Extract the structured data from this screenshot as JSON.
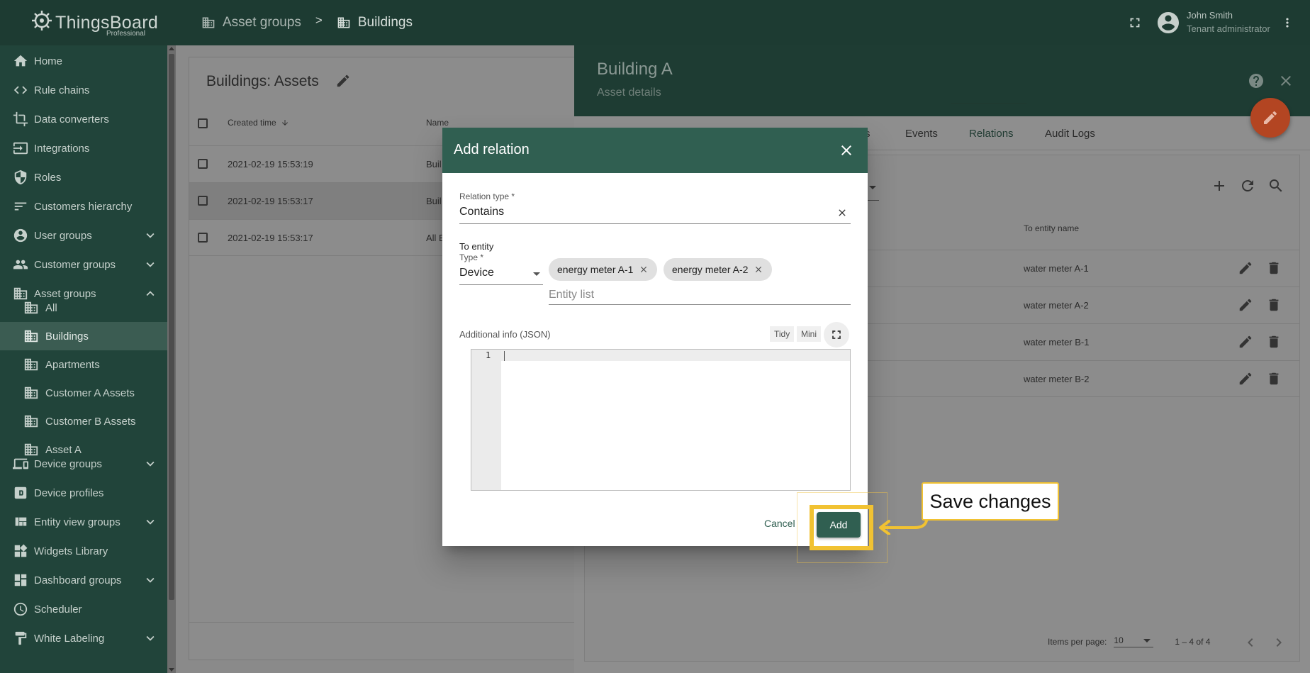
{
  "app": {
    "name": "ThingsBoard",
    "edition": "Professional"
  },
  "breadcrumb": [
    {
      "label": "Asset groups"
    },
    {
      "label": "Buildings"
    }
  ],
  "breadcrumb_separator": ">",
  "user": {
    "name": "John Smith",
    "role": "Tenant administrator"
  },
  "sidebar": {
    "items": [
      {
        "label": "Home",
        "icon": "home-icon"
      },
      {
        "label": "Rule chains",
        "icon": "code-arrows-icon"
      },
      {
        "label": "Data converters",
        "icon": "crop-icon"
      },
      {
        "label": "Integrations",
        "icon": "input-icon"
      },
      {
        "label": "Roles",
        "icon": "shield-icon"
      },
      {
        "label": "Customers hierarchy",
        "icon": "sort-lines-icon"
      },
      {
        "label": "User groups",
        "icon": "account-circle-icon",
        "expandable": true
      },
      {
        "label": "Customer groups",
        "icon": "people-icon",
        "expandable": true
      },
      {
        "label": "Asset groups",
        "icon": "building-icon",
        "expanded": true
      },
      {
        "label": "All",
        "icon": "building-icon",
        "sub": true
      },
      {
        "label": "Buildings",
        "icon": "building-icon",
        "sub": true,
        "active": true
      },
      {
        "label": "Apartments",
        "icon": "building-icon",
        "sub": true
      },
      {
        "label": "Customer A Assets",
        "icon": "building-icon",
        "sub": true
      },
      {
        "label": "Customer B Assets",
        "icon": "building-icon",
        "sub": true
      },
      {
        "label": "Asset A",
        "icon": "building-icon",
        "sub": true
      },
      {
        "label": "Device groups",
        "icon": "devices-icon",
        "expandable": true
      },
      {
        "label": "Device profiles",
        "icon": "profile-icon"
      },
      {
        "label": "Entity view groups",
        "icon": "view-quilt-icon",
        "expandable": true
      },
      {
        "label": "Widgets Library",
        "icon": "widgets-icon"
      },
      {
        "label": "Dashboard groups",
        "icon": "dashboard-icon",
        "expandable": true
      },
      {
        "label": "Scheduler",
        "icon": "clock-icon"
      },
      {
        "label": "White Labeling",
        "icon": "format-paint-icon",
        "expandable": true
      }
    ]
  },
  "asset_list": {
    "title": "Buildings: Assets",
    "columns": {
      "created": "Created time",
      "name": "Name"
    },
    "rows": [
      {
        "created": "2021-02-19 15:53:19",
        "name": "Buil"
      },
      {
        "created": "2021-02-19 15:53:17",
        "name": "Buil"
      },
      {
        "created": "2021-02-19 15:53:17",
        "name": "All E"
      }
    ]
  },
  "details": {
    "title": "Building A",
    "subtitle": "Asset details",
    "tabs": [
      {
        "label": "s"
      },
      {
        "label": "Events"
      },
      {
        "label": "Relations",
        "active": true
      },
      {
        "label": "Audit Logs"
      }
    ],
    "relations": {
      "column_to_entity_name": "To entity name",
      "rows": [
        {
          "to_entity_name": "water meter A-1"
        },
        {
          "to_entity_name": "water meter A-2"
        },
        {
          "to_entity_name": "water meter B-1"
        },
        {
          "to_entity_name": "water meter B-2"
        }
      ]
    },
    "pager": {
      "items_per_page_label": "Items per page:",
      "items_per_page": "10",
      "range": "1 – 4 of 4"
    }
  },
  "dialog": {
    "title": "Add relation",
    "relation_type_label": "Relation type *",
    "relation_type_value": "Contains",
    "to_entity_label": "To entity",
    "type_label": "Type *",
    "type_value": "Device",
    "chips": [
      "energy meter A-1",
      "energy meter A-2"
    ],
    "entity_list_placeholder": "Entity list",
    "additional_info_label": "Additional info (JSON)",
    "tidy_label": "Tidy",
    "mini_label": "Mini",
    "editor_line_number": "1",
    "cancel_label": "Cancel",
    "add_label": "Add"
  },
  "annotation": {
    "callout_text": "Save changes",
    "highlight_color": "#f1c232"
  },
  "colors": {
    "primary": "#305f51",
    "topbar": "#1d3b32",
    "sidebar": "#21443a",
    "fab": "#b34522"
  }
}
